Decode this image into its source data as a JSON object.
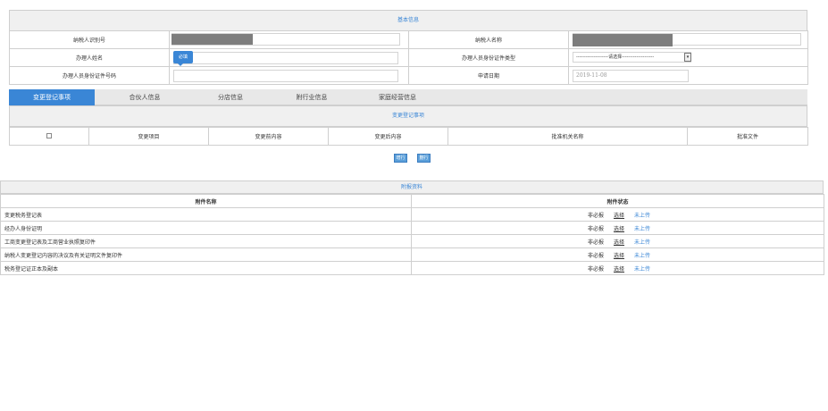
{
  "basic_info": {
    "title": "基本信息",
    "taxpayer_id_label": "纳税人识别号",
    "taxpayer_name_label": "纳税人名称",
    "handler_name_label": "办理人姓名",
    "handler_name_tip": "必填",
    "handler_id_type_label": "办理人员身份证件类型",
    "handler_id_type_value": "--------------------请选择--------------------",
    "handler_id_number_label": "办理人员身份证件号码",
    "apply_date_label": "申请日期",
    "apply_date_value": "2019-11-08"
  },
  "tabs": [
    {
      "label": "变更登记事项",
      "active": true
    },
    {
      "label": "合伙人信息",
      "active": false
    },
    {
      "label": "分店信息",
      "active": false
    },
    {
      "label": "附行业信息",
      "active": false
    },
    {
      "label": "家庭经营信息",
      "active": false
    }
  ],
  "change_section": {
    "title": "变更登记事项",
    "columns": [
      "变更项目",
      "变更前内容",
      "变更后内容",
      "批准机关名称",
      "批准文件"
    ]
  },
  "buttons": {
    "add_row": "增行",
    "delete_row": "删行"
  },
  "attachments": {
    "title": "附报资料",
    "col_name": "附件名称",
    "col_status": "附件状态",
    "rows": [
      {
        "name": "变更税务登记表",
        "required": "非必报",
        "select": "选择",
        "status": "未上传"
      },
      {
        "name": "经办人身份证明",
        "required": "非必报",
        "select": "选择",
        "status": "未上传"
      },
      {
        "name": "工商变更登记表及工商营业执照复印件",
        "required": "非必报",
        "select": "选择",
        "status": "未上传"
      },
      {
        "name": "纳税人变更登记内容的决议及有关证明文件复印件",
        "required": "非必报",
        "select": "选择",
        "status": "未上传"
      },
      {
        "name": "税务登记证正本及副本",
        "required": "非必报",
        "select": "选择",
        "status": "未上传"
      }
    ]
  },
  "colors": {
    "accent": "#3a86d6",
    "border": "#cfcfcf",
    "header_bg": "#f0f0f0"
  }
}
